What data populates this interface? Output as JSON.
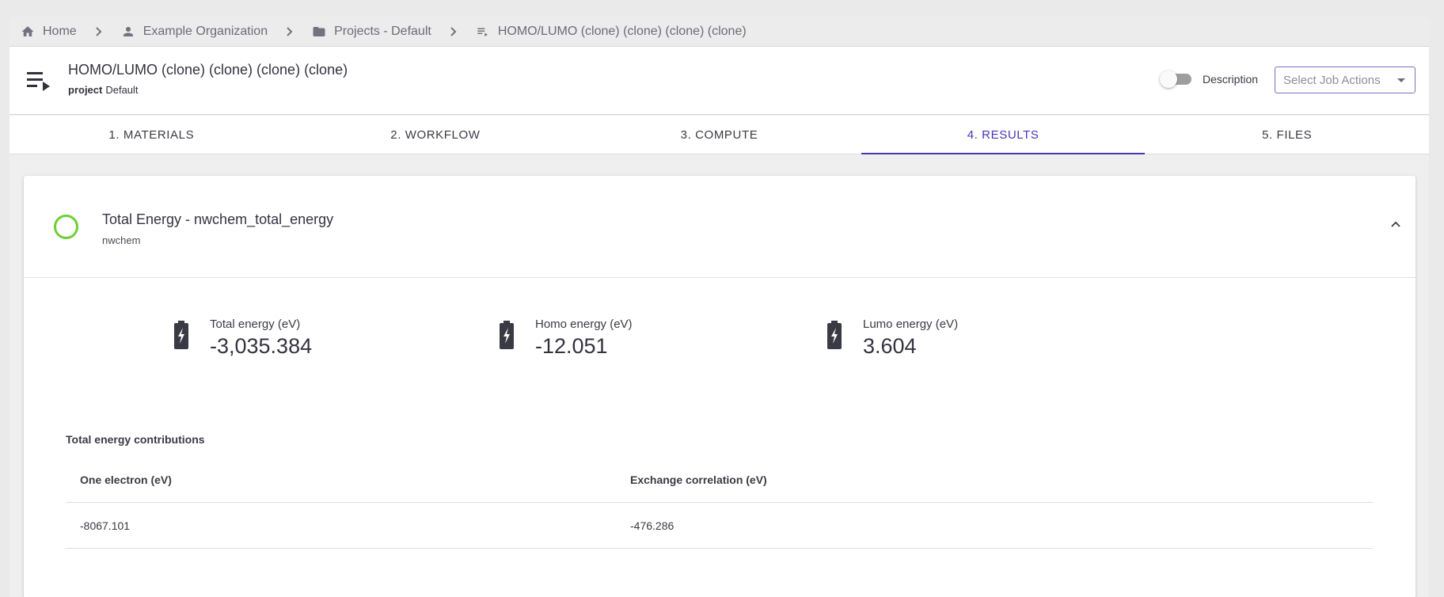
{
  "breadcrumb": {
    "items": [
      {
        "label": "Home",
        "icon": "home-icon"
      },
      {
        "label": "Example Organization",
        "icon": "person-icon"
      },
      {
        "label": "Projects - Default",
        "icon": "folder-icon"
      },
      {
        "label": "HOMO/LUMO (clone) (clone) (clone) (clone)",
        "icon": "playlist-play-icon"
      }
    ]
  },
  "header": {
    "title": "HOMO/LUMO (clone) (clone) (clone) (clone)",
    "project_label": "project",
    "project_value": "Default",
    "description_label": "Description",
    "description_toggle_on": false,
    "actions_placeholder": "Select Job Actions"
  },
  "tabs": [
    {
      "label": "1. MATERIALS",
      "active": false
    },
    {
      "label": "2. WORKFLOW",
      "active": false
    },
    {
      "label": "3. COMPUTE",
      "active": false
    },
    {
      "label": "4. RESULTS",
      "active": true
    },
    {
      "label": "5. FILES",
      "active": false
    }
  ],
  "unit": {
    "title": "Total Energy - nwchem_total_energy",
    "subtitle": "nwchem",
    "status_color": "#6bd133",
    "metrics": [
      {
        "label": "Total energy (eV)",
        "value": "-3,035.384",
        "icon": "battery-charging-icon"
      },
      {
        "label": "Homo energy (eV)",
        "value": "-12.051",
        "icon": "battery-charging-icon"
      },
      {
        "label": "Lumo energy (eV)",
        "value": "3.604",
        "icon": "battery-charging-icon"
      }
    ],
    "contributions": {
      "title": "Total energy contributions",
      "columns": [
        "One electron (eV)",
        "Exchange correlation (eV)"
      ],
      "rows": [
        [
          "-8067.101",
          "-476.286"
        ]
      ]
    }
  },
  "colors": {
    "accent": "#4a35b8",
    "status_success": "#6bd133"
  }
}
